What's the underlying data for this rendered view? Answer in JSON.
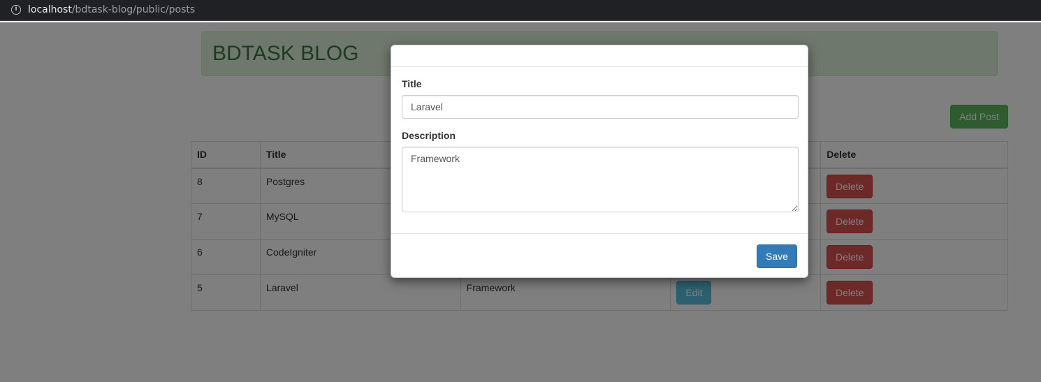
{
  "browser": {
    "host": "localhost",
    "path": "/bdtask-blog/public/posts",
    "info_icon": "info-icon"
  },
  "banner": {
    "title": "BDTASK BLOG"
  },
  "toolbar": {
    "add_post_label": "Add Post"
  },
  "table": {
    "headers": {
      "id": "ID",
      "title": "Title",
      "delete": "Delete"
    },
    "rows": [
      {
        "id": "8",
        "title": "Postgres",
        "description": "",
        "edit_label": "",
        "delete_label": "Delete"
      },
      {
        "id": "7",
        "title": "MySQL",
        "description": "",
        "edit_label": "",
        "delete_label": "Delete"
      },
      {
        "id": "6",
        "title": "CodeIgniter",
        "description": "",
        "edit_label": "",
        "delete_label": "Delete"
      },
      {
        "id": "5",
        "title": "Laravel",
        "description": "Framework",
        "edit_label": "Edit",
        "delete_label": "Delete"
      }
    ]
  },
  "modal": {
    "title_label": "Title",
    "title_value": "Laravel",
    "description_label": "Description",
    "description_value": "Framework",
    "save_label": "Save"
  },
  "colors": {
    "success": "#5cb85c",
    "info": "#5bc0de",
    "danger": "#d9534f",
    "primary": "#337ab7",
    "banner_bg": "#dff0d8",
    "banner_text": "#3c763d"
  }
}
